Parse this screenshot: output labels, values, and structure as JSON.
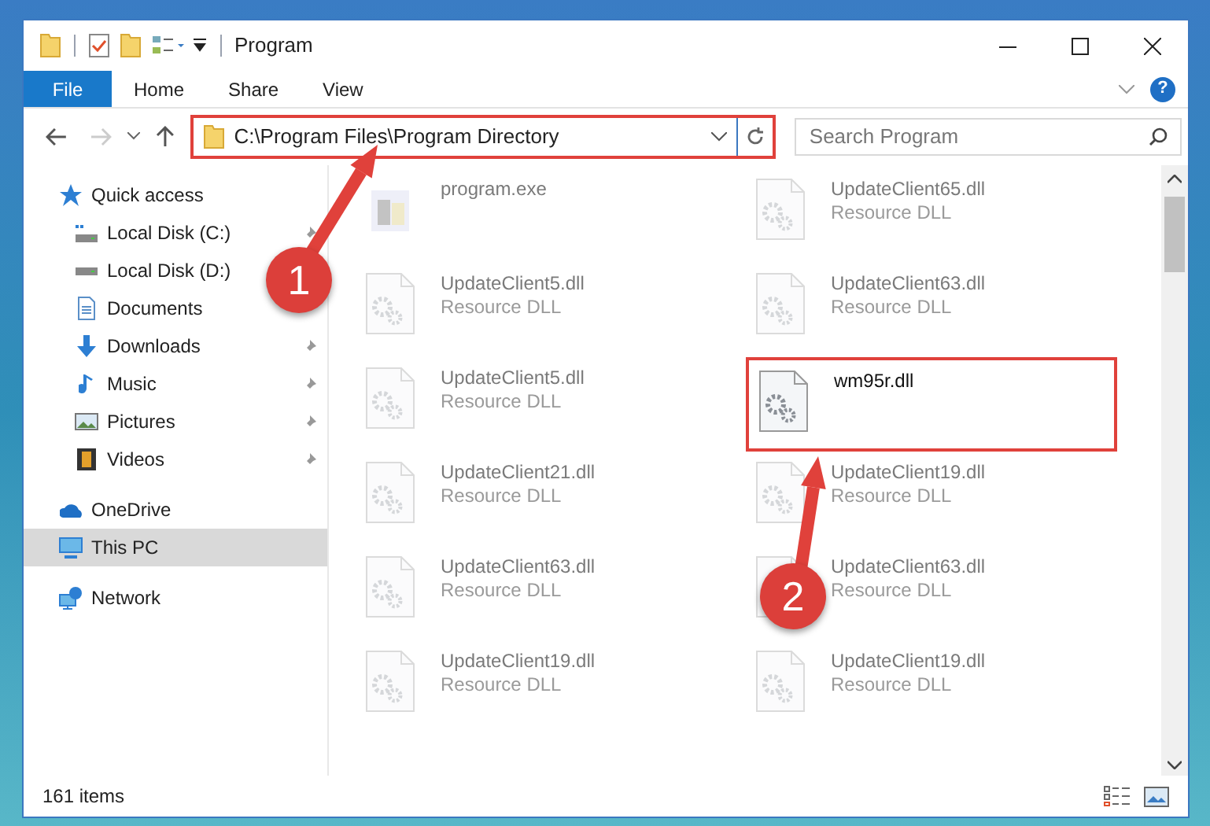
{
  "window": {
    "title": "Program"
  },
  "ribbon_tabs": [
    {
      "label": "File",
      "kind": "file"
    },
    {
      "label": "Home",
      "kind": "tab"
    },
    {
      "label": "Share",
      "kind": "tab"
    },
    {
      "label": "View",
      "kind": "tab"
    }
  ],
  "help_button": "?",
  "address": {
    "path": "C:\\Program Files\\Program Directory",
    "highlighted": true
  },
  "search": {
    "placeholder": "Search Program"
  },
  "sidebar": {
    "items": [
      {
        "label": "Quick access",
        "selected": false,
        "children": [
          {
            "label": "Local Disk (C:)",
            "pinned": true,
            "selected": false
          },
          {
            "label": "Local Disk (D:)",
            "pinned": false,
            "selected": false
          },
          {
            "label": "Documents",
            "pinned": false,
            "selected": false
          },
          {
            "label": "Downloads",
            "pinned": true,
            "selected": false
          },
          {
            "label": "Music",
            "pinned": true,
            "selected": false
          },
          {
            "label": "Pictures",
            "pinned": true,
            "selected": false
          },
          {
            "label": "Videos",
            "pinned": true,
            "selected": false
          }
        ]
      },
      {
        "label": "OneDrive",
        "selected": false
      },
      {
        "label": "This PC",
        "selected": true
      },
      {
        "label": "Network",
        "selected": false
      }
    ]
  },
  "files": [
    {
      "name": "program.exe",
      "kind": "exe",
      "dimmed": true,
      "highlighted": false
    },
    {
      "name": "UpdateClient65.dll",
      "type": "Resource DLL",
      "kind": "dll",
      "dimmed": true,
      "highlighted": false
    },
    {
      "name": "UpdateClient5.dll",
      "type": "Resource DLL",
      "kind": "dll",
      "dimmed": true,
      "highlighted": false
    },
    {
      "name": "UpdateClient63.dll",
      "type": "Resource DLL",
      "kind": "dll",
      "dimmed": true,
      "highlighted": false
    },
    {
      "name": "UpdateClient5.dll",
      "type": "Resource DLL",
      "kind": "dll",
      "dimmed": true,
      "highlighted": false
    },
    {
      "name": "wm95r.dll",
      "kind": "dll",
      "dimmed": false,
      "highlighted": true
    },
    {
      "name": "UpdateClient21.dll",
      "type": "Resource DLL",
      "kind": "dll",
      "dimmed": true,
      "highlighted": false
    },
    {
      "name": "UpdateClient19.dll",
      "type": "Resource DLL",
      "kind": "dll",
      "dimmed": true,
      "highlighted": false
    },
    {
      "name": "UpdateClient63.dll",
      "type": "Resource DLL",
      "kind": "dll",
      "dimmed": true,
      "highlighted": false
    },
    {
      "name": "UpdateClient63.dll",
      "type": "Resource DLL",
      "kind": "dll",
      "dimmed": true,
      "highlighted": false
    },
    {
      "name": "UpdateClient19.dll",
      "type": "Resource DLL",
      "kind": "dll",
      "dimmed": true,
      "highlighted": false
    },
    {
      "name": "UpdateClient19.dll",
      "type": "Resource DLL",
      "kind": "dll",
      "dimmed": true,
      "highlighted": false
    }
  ],
  "status_bar": {
    "item_count": "161 items"
  },
  "annotations": [
    {
      "label": "1"
    },
    {
      "label": "2"
    }
  ]
}
